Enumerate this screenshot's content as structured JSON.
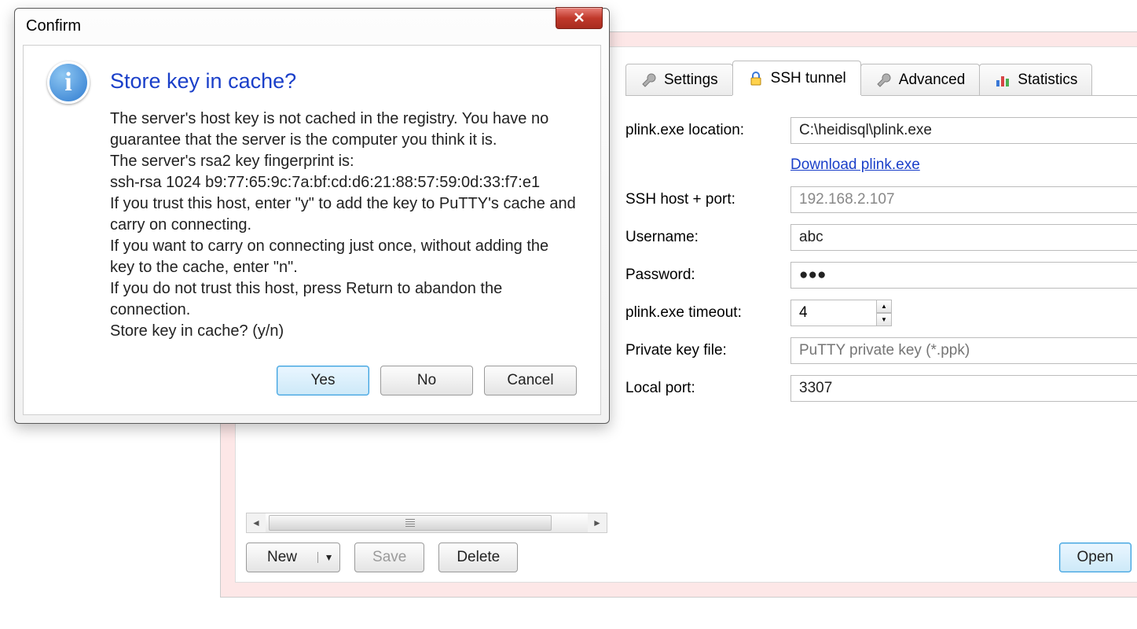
{
  "dialog": {
    "title": "Confirm",
    "heading": "Store key in cache?",
    "body": "The server's host key is not cached in the registry. You have no guarantee that the server is the computer you think it is.\nThe server's rsa2 key fingerprint is:\nssh-rsa 1024 b9:77:65:9c:7a:bf:cd:d6:21:88:57:59:0d:33:f7:e1\nIf you trust this host, enter \"y\" to add the key to PuTTY's cache and carry on connecting.\nIf you want to carry on connecting just once, without adding the key to the cache, enter \"n\".\nIf you do not trust this host, press Return to abandon the connection.\nStore key in cache? (y/n)",
    "yes": "Yes",
    "no": "No",
    "cancel": "Cancel"
  },
  "tabs": {
    "settings": "Settings",
    "ssh": "SSH tunnel",
    "advanced": "Advanced",
    "statistics": "Statistics"
  },
  "form": {
    "plink_location_label": "plink.exe location:",
    "plink_location_value": "C:\\heidisql\\plink.exe",
    "download_link": "Download plink.exe",
    "ssh_host_label": "SSH host + port:",
    "ssh_host_value": "192.168.2.107",
    "username_label": "Username:",
    "username_value": "abc",
    "password_label": "Password:",
    "password_value": "●●●",
    "plink_timeout_label": "plink.exe timeout:",
    "plink_timeout_value": "4",
    "private_key_label": "Private key file:",
    "private_key_placeholder": "PuTTY private key (*.ppk)",
    "local_port_label": "Local port:",
    "local_port_value": "3307"
  },
  "buttons": {
    "new": "New",
    "save": "Save",
    "delete": "Delete",
    "open": "Open"
  }
}
